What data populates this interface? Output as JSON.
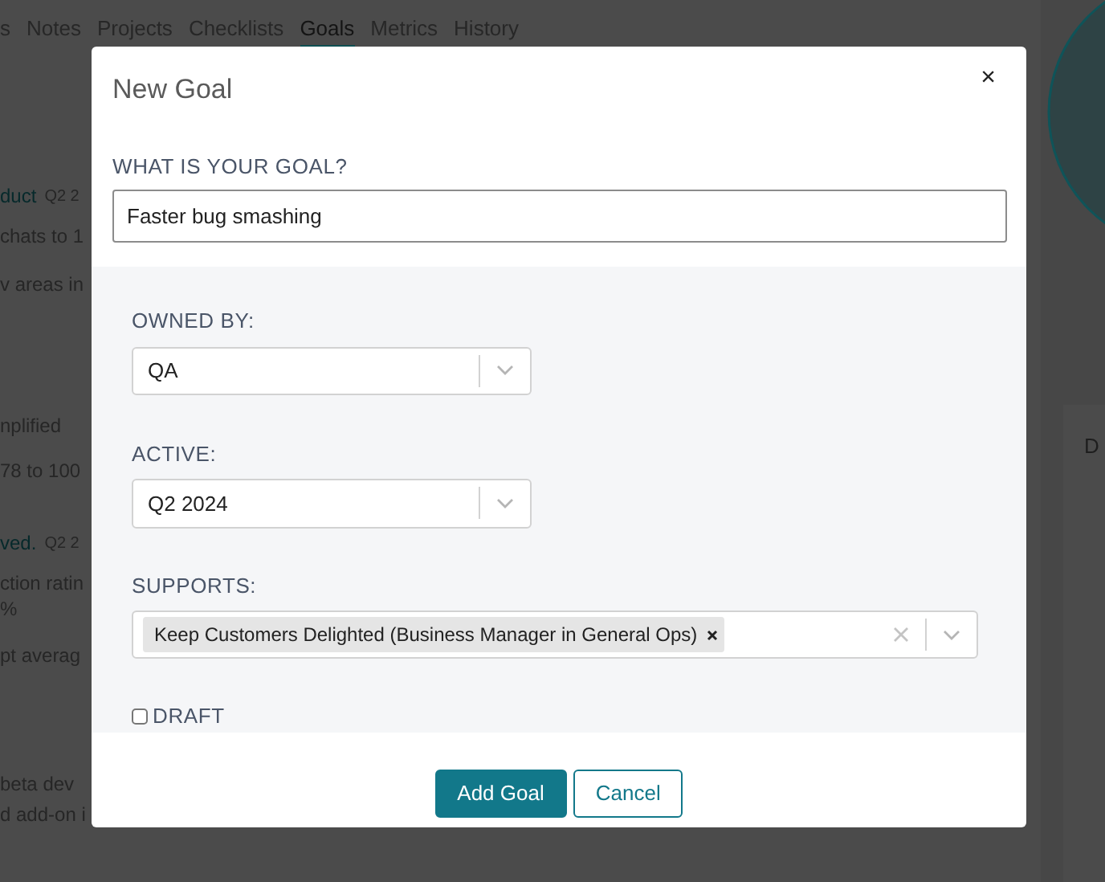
{
  "background": {
    "tabs": [
      {
        "label": "s",
        "selected": false
      },
      {
        "label": "Notes",
        "selected": false
      },
      {
        "label": "Projects",
        "selected": false
      },
      {
        "label": "Checklists",
        "selected": false
      },
      {
        "label": "Goals",
        "selected": true
      },
      {
        "label": "Metrics",
        "selected": false
      },
      {
        "label": "History",
        "selected": false
      }
    ],
    "items": [
      {
        "kind": "heading",
        "text": "duct",
        "tag": "Q2 2"
      },
      {
        "kind": "line",
        "text": "chats to 1"
      },
      {
        "kind": "line",
        "text": "v areas in"
      },
      {
        "kind": "line",
        "text": "nplified"
      },
      {
        "kind": "line",
        "text": "78 to 100"
      },
      {
        "kind": "heading",
        "text": "ved.",
        "tag": "Q2 2"
      },
      {
        "kind": "line",
        "text": "ction ratin"
      },
      {
        "kind": "line",
        "text": "%"
      },
      {
        "kind": "line",
        "text": "pt averag"
      },
      {
        "kind": "line",
        "text": "beta dev"
      },
      {
        "kind": "line",
        "text": "d add-on i"
      }
    ],
    "side_card": {
      "text": "D"
    }
  },
  "dialog": {
    "title": "New Goal",
    "close": "×",
    "goal": {
      "label": "WHAT IS YOUR GOAL?",
      "value": "Faster bug smashing"
    },
    "fields": [
      {
        "kind": "select",
        "label": "OWNED BY:",
        "value": "QA"
      },
      {
        "kind": "select",
        "label": "ACTIVE:",
        "value": "Q2 2024"
      },
      {
        "kind": "multiselect",
        "label": "SUPPORTS:",
        "chips": [
          "Keep Customers Delighted (Business Manager in General Ops)"
        ]
      }
    ],
    "draft": {
      "label": "DRAFT",
      "checked": false
    },
    "buttons": [
      {
        "kind": "primary",
        "label": "Add Goal"
      },
      {
        "kind": "secondary",
        "label": "Cancel"
      }
    ]
  }
}
